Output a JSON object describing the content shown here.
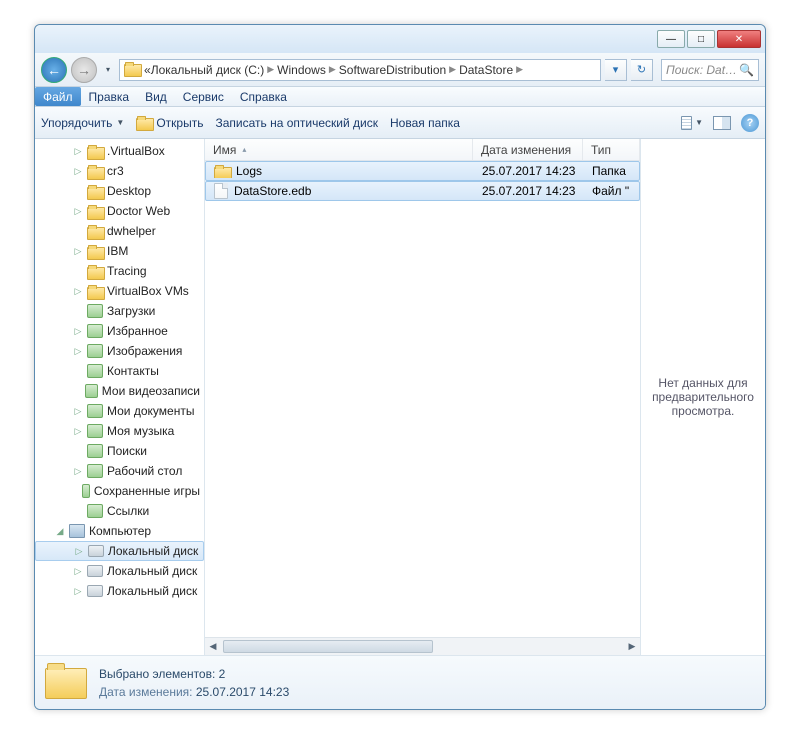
{
  "titlebar": {
    "min": "—",
    "max": "□",
    "close": "✕"
  },
  "nav": {
    "back": "←",
    "fwd": "→",
    "path_prefix": "«",
    "path": [
      "Локальный диск (C:)",
      "Windows",
      "SoftwareDistribution",
      "DataStore"
    ],
    "refresh": "↻",
    "search_placeholder": "Поиск: Dat…"
  },
  "menubar": {
    "file": "Файл",
    "edit": "Правка",
    "view": "Вид",
    "tools": "Сервис",
    "help": "Справка"
  },
  "toolbar": {
    "organize": "Упорядочить",
    "open": "Открыть",
    "burn": "Записать на оптический диск",
    "newfolder": "Новая папка"
  },
  "columns": {
    "name": "Имя",
    "date": "Дата изменения",
    "type": "Тип"
  },
  "files": [
    {
      "icon": "folder",
      "name": "Logs",
      "date": "25.07.2017 14:23",
      "type": "Папка"
    },
    {
      "icon": "file",
      "name": "DataStore.edb",
      "date": "25.07.2017 14:23",
      "type": "Файл \""
    }
  ],
  "tree": [
    {
      "lvl": 2,
      "icon": "folder",
      "label": ".VirtualBox",
      "exp": "▷"
    },
    {
      "lvl": 2,
      "icon": "folder",
      "label": "cr3",
      "exp": "▷"
    },
    {
      "lvl": 2,
      "icon": "folder",
      "label": "Desktop",
      "exp": ""
    },
    {
      "lvl": 2,
      "icon": "folder",
      "label": "Doctor Web",
      "exp": "▷"
    },
    {
      "lvl": 2,
      "icon": "folder",
      "label": "dwhelper",
      "exp": ""
    },
    {
      "lvl": 2,
      "icon": "folder",
      "label": "IBM",
      "exp": "▷"
    },
    {
      "lvl": 2,
      "icon": "folder",
      "label": "Tracing",
      "exp": ""
    },
    {
      "lvl": 2,
      "icon": "folder",
      "label": "VirtualBox VMs",
      "exp": "▷"
    },
    {
      "lvl": 2,
      "icon": "spec",
      "label": "Загрузки",
      "exp": ""
    },
    {
      "lvl": 2,
      "icon": "spec",
      "label": "Избранное",
      "exp": "▷"
    },
    {
      "lvl": 2,
      "icon": "spec",
      "label": "Изображения",
      "exp": "▷"
    },
    {
      "lvl": 2,
      "icon": "spec",
      "label": "Контакты",
      "exp": ""
    },
    {
      "lvl": 2,
      "icon": "spec",
      "label": "Мои видеозаписи",
      "exp": ""
    },
    {
      "lvl": 2,
      "icon": "spec",
      "label": "Мои документы",
      "exp": "▷"
    },
    {
      "lvl": 2,
      "icon": "spec",
      "label": "Моя музыка",
      "exp": "▷"
    },
    {
      "lvl": 2,
      "icon": "spec",
      "label": "Поиски",
      "exp": ""
    },
    {
      "lvl": 2,
      "icon": "spec",
      "label": "Рабочий стол",
      "exp": "▷"
    },
    {
      "lvl": 2,
      "icon": "spec",
      "label": "Сохраненные игры",
      "exp": ""
    },
    {
      "lvl": 2,
      "icon": "spec",
      "label": "Ссылки",
      "exp": ""
    },
    {
      "lvl": 1,
      "icon": "comp",
      "label": "Компьютер",
      "exp": "◢"
    },
    {
      "lvl": 2,
      "icon": "disk",
      "label": "Локальный диск",
      "exp": "▷",
      "sel": true
    },
    {
      "lvl": 2,
      "icon": "disk",
      "label": "Локальный диск",
      "exp": "▷"
    },
    {
      "lvl": 2,
      "icon": "disk",
      "label": "Локальный диск",
      "exp": "▷"
    }
  ],
  "preview": {
    "text": "Нет данных для предварительного просмотра."
  },
  "details": {
    "selected": "Выбрано элементов: 2",
    "date_label": "Дата изменения:",
    "date_value": "25.07.2017 14:23"
  }
}
